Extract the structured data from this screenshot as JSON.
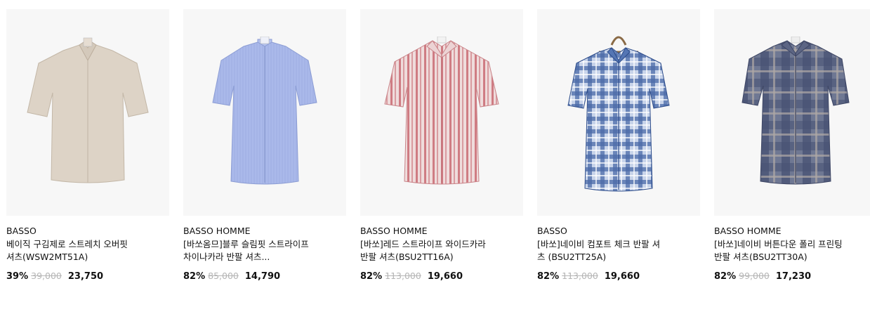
{
  "products": [
    {
      "brand": "BASSO",
      "title_line1": "베이직 구김제로 스트레치 오버핏",
      "title_line2": "셔츠(WSW2MT51A)",
      "discount_rate": "39%",
      "original_price": "39,000",
      "sale_price": "23,750",
      "shirt_style": "solid",
      "colors": {
        "main": "#ddd3c6",
        "shade": "#c9bdae",
        "line": "#b8ab9b"
      }
    },
    {
      "brand": "BASSO HOMME",
      "title_line1": "[바쏘옴므]블루 슬림핏 스트라이프",
      "title_line2": "차이나카라 반팔 셔츠...",
      "discount_rate": "82%",
      "original_price": "85,000",
      "sale_price": "14,790",
      "shirt_style": "solid-blue",
      "colors": {
        "main": "#a9b8e8",
        "shade": "#8fa1d8",
        "line": "#7d8fc9"
      }
    },
    {
      "brand": "BASSO HOMME",
      "title_line1": "[바쏘]레드 스트라이프 와이드카라",
      "title_line2": "반팔 셔츠(BSU2TT16A)",
      "discount_rate": "82%",
      "original_price": "113,000",
      "sale_price": "19,660",
      "shirt_style": "stripe",
      "colors": {
        "main": "#ead3d3",
        "shade": "#d99b9f",
        "line": "#c96f76"
      }
    },
    {
      "brand": "BASSO",
      "title_line1": "[바쏘]네이비 컴포트 체크 반팔 셔",
      "title_line2": "츠 (BSU2TT25A)",
      "discount_rate": "82%",
      "original_price": "113,000",
      "sale_price": "19,660",
      "shirt_style": "check",
      "colors": {
        "main": "#c9d5ea",
        "shade": "#5f7fb8",
        "line": "#2f4f8c"
      }
    },
    {
      "brand": "BASSO HOMME",
      "title_line1": "[바쏘]네이비 버튼다운 폴리 프린팅",
      "title_line2": "반팔 셔츠(BSU2TT30A)",
      "discount_rate": "82%",
      "original_price": "99,000",
      "sale_price": "17,230",
      "shirt_style": "plaid",
      "colors": {
        "main": "#7d86a0",
        "shade": "#4c5575",
        "line": "#a9a6a9"
      }
    }
  ]
}
